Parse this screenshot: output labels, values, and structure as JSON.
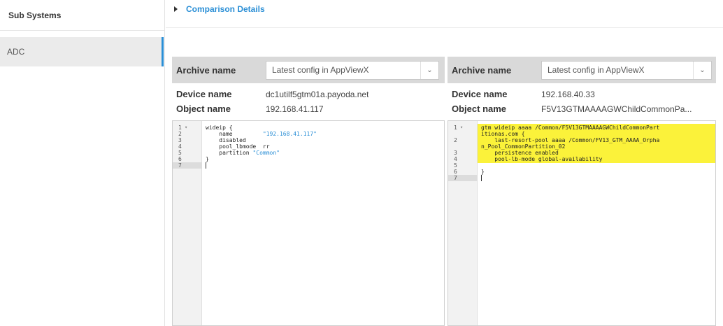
{
  "sidebar": {
    "header": "Sub Systems",
    "items": [
      {
        "label": "ADC"
      }
    ]
  },
  "section": {
    "title": "Comparison Details"
  },
  "left": {
    "archive_label": "Archive name",
    "archive_value": "Latest config in AppViewX",
    "device_label": "Device name",
    "device_value": "dc1utilf5gtm01a.payoda.net",
    "object_label": "Object name",
    "object_value": "192.168.41.117",
    "lines": [
      {
        "num": "1",
        "fold": "▾",
        "text": "wideip {",
        "str": ""
      },
      {
        "num": "2",
        "fold": "",
        "text": "    name         ",
        "str": "\"192.168.41.117\""
      },
      {
        "num": "3",
        "fold": "",
        "text": "    disabled",
        "str": ""
      },
      {
        "num": "4",
        "fold": "",
        "text": "    pool_lbmode  rr",
        "str": ""
      },
      {
        "num": "5",
        "fold": "",
        "text": "    partition ",
        "str": "\"Common\""
      },
      {
        "num": "6",
        "fold": "",
        "text": "}",
        "str": ""
      },
      {
        "num": "7",
        "fold": "",
        "text": "",
        "str": ""
      }
    ]
  },
  "right": {
    "archive_label": "Archive name",
    "archive_value": "Latest config in AppViewX",
    "device_label": "Device name",
    "device_value": "192.168.40.33",
    "object_label": "Object name",
    "object_value": "F5V13GTMAAAAGWChildCommonPa...",
    "lines": [
      {
        "num": "1",
        "fold": "▾",
        "text": "gtm wideip aaaa /Common/F5V13GTMAAAAGWChildCommonPart"
      },
      {
        "num": "",
        "fold": "",
        "text": "itionas.com {"
      },
      {
        "num": "2",
        "fold": "",
        "text": "    last-resort-pool aaaa /Common/FV13_GTM_AAAA_Orpha"
      },
      {
        "num": "",
        "fold": "",
        "text": "n_Pool_CommonPartition_02"
      },
      {
        "num": "3",
        "fold": "",
        "text": "    persistence enabled"
      },
      {
        "num": "4",
        "fold": "",
        "text": "    pool-lb-mode global-availability"
      },
      {
        "num": "5",
        "fold": "",
        "text": ""
      },
      {
        "num": "6",
        "fold": "",
        "text": "}"
      },
      {
        "num": "7",
        "fold": "",
        "text": ""
      }
    ]
  },
  "colors": {
    "accent": "#2b8fd6",
    "highlight": "#fbf23a",
    "panel_header": "#d9d9d9"
  },
  "icons": {
    "section_caret": "caret-right-icon",
    "select_arrow": "chevron-down-icon"
  }
}
